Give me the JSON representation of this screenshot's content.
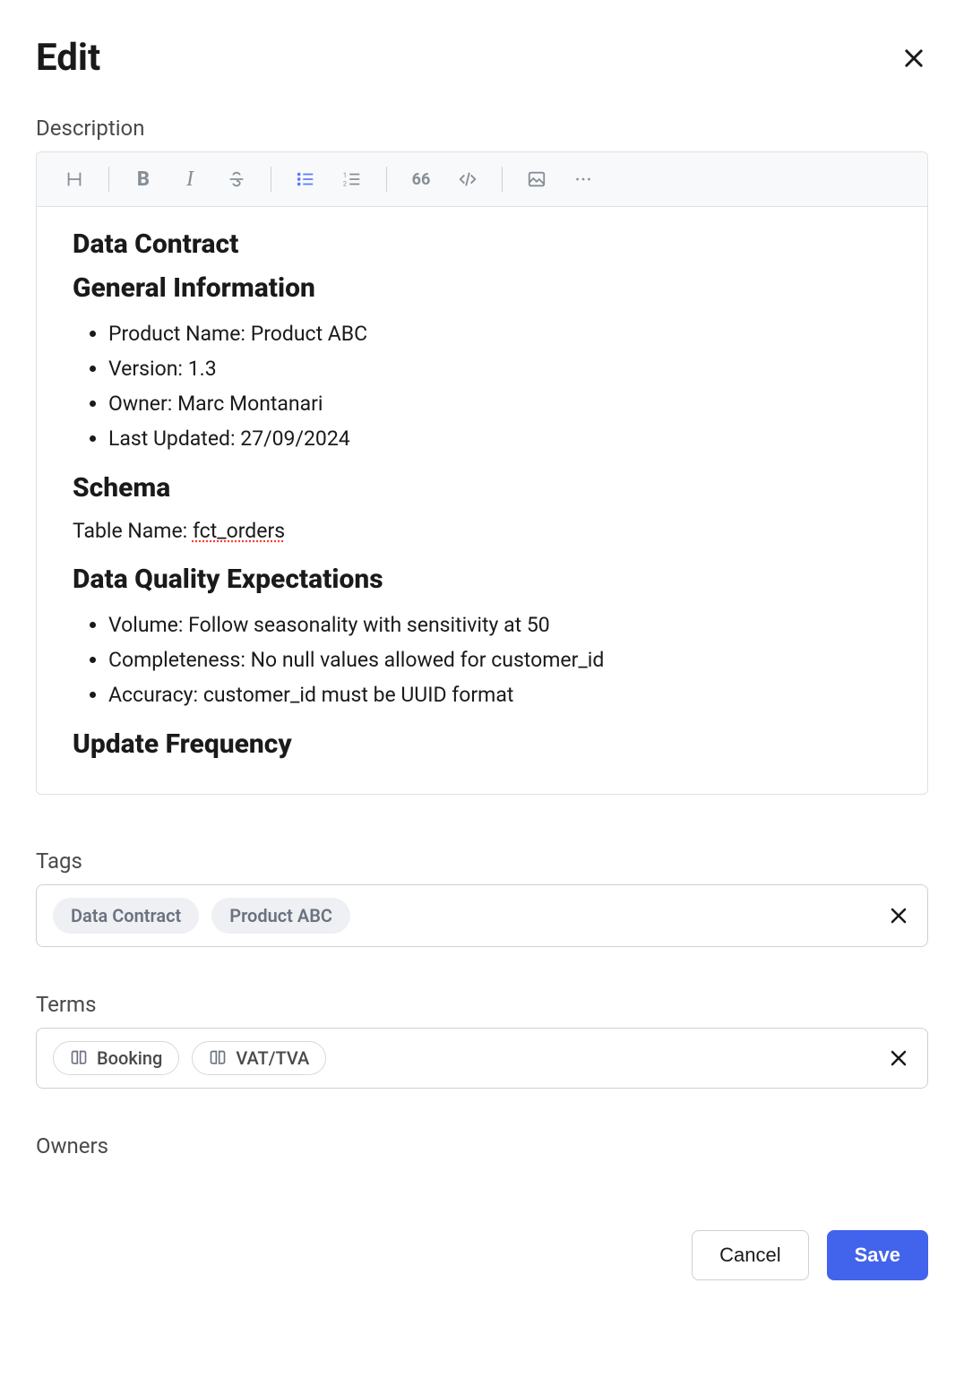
{
  "header": {
    "title": "Edit"
  },
  "description": {
    "label": "Description",
    "content": {
      "h1": "Data Contract",
      "h2_general": "General Information",
      "general_items": [
        {
          "label": "Product Name:",
          "value": " Product ABC"
        },
        {
          "label": "Version:",
          "value": " 1.3"
        },
        {
          "label": "Owner:",
          "value": " Marc Montanari"
        },
        {
          "label": "Last Updated:",
          "value": " 27/09/2024"
        }
      ],
      "h2_schema": "Schema",
      "schema_line_label": "Table Name: ",
      "schema_line_value": "fct_orders",
      "h2_dq": "Data Quality Expectations",
      "dq_items": [
        {
          "label": "Volume:",
          "value": " Follow seasonality with sensitivity at 50"
        },
        {
          "label": "Completeness:",
          "value": " No null values allowed for customer_id"
        },
        {
          "label": "Accuracy:",
          "value": " customer_id must be UUID format"
        }
      ],
      "h2_update": "Update Frequency"
    }
  },
  "tags": {
    "label": "Tags",
    "items": [
      "Data Contract",
      "Product ABC"
    ]
  },
  "terms": {
    "label": "Terms",
    "items": [
      "Booking",
      "VAT/TVA"
    ]
  },
  "owners": {
    "label": "Owners"
  },
  "footer": {
    "cancel": "Cancel",
    "save": "Save"
  },
  "toolbar": {
    "quote": "66"
  }
}
